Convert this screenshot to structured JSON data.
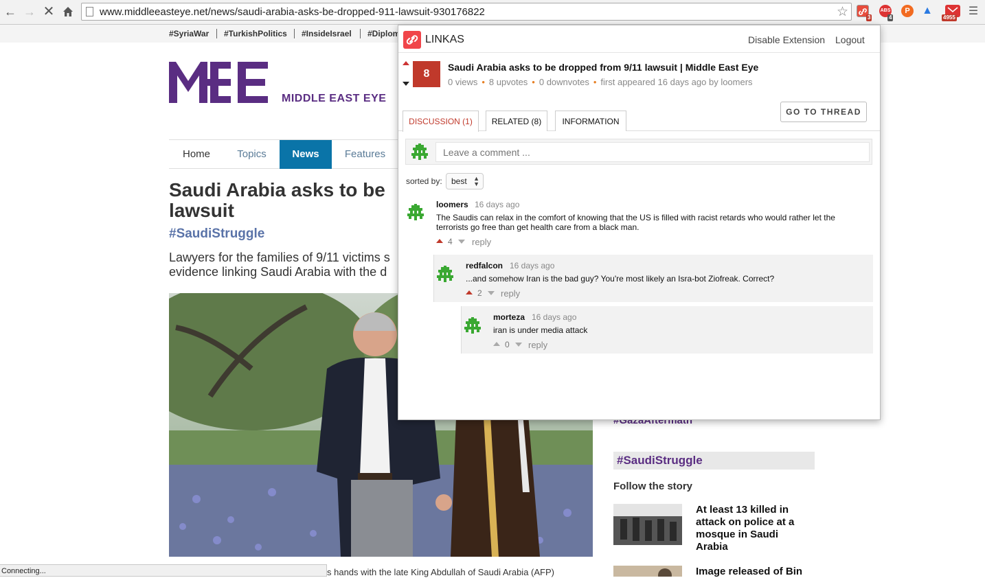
{
  "browser": {
    "url": "www.middleeasteye.net/news/saudi-arabia-asks-be-dropped-911-lawsuit-930176822",
    "linkas_badge": "3",
    "abs_badge": "4",
    "mail_badge": "4955",
    "status_text": "Connecting..."
  },
  "site": {
    "hashtags": [
      "#SyriaWar",
      "#TurkishPolitics",
      "#InsideIsrael",
      "#Diplom"
    ],
    "logo_text": "MIDDLE EAST EYE",
    "nav": [
      "Home",
      "Topics",
      "News",
      "Features"
    ],
    "headline": "Saudi Arabia asks to be ",
    "headline_line2": "lawsuit",
    "article_hashtag": "#SaudiStruggle",
    "lede": "Lawyers for the families of 9/11 victims s evidence linking Saudi Arabia with the d",
    "caption": "s hands with the late King Abdullah of Saudi Arabia (AFP)",
    "sidebar_partial": "#GazaAftermath",
    "sidebar_tag": "#SaudiStruggle",
    "follow_label": "Follow the story",
    "stories": [
      {
        "title": "At least 13 killed in attack on police at a mosque in Saudi Arabia"
      },
      {
        "title": "Image released of Bin"
      }
    ]
  },
  "linkas": {
    "brand": "LINKAS",
    "disable_label": "Disable Extension",
    "logout_label": "Logout",
    "score": "8",
    "title": "Saudi Arabia asks to be dropped from 9/11 lawsuit | Middle East Eye",
    "meta": {
      "views": "0 views",
      "upvotes": "8 upvotes",
      "downvotes": "0 downvotes",
      "first": "first appeared 16 days ago by loomers"
    },
    "goto_label": "GO TO THREAD",
    "tabs": [
      "DISCUSSION (1)",
      "RELATED (8)",
      "INFORMATION"
    ],
    "comment_placeholder": "Leave a comment ...",
    "sorted_label": "sorted by:",
    "sort_value": "best",
    "reply_label": "reply",
    "comments": [
      {
        "user": "loomers",
        "time": "16 days ago",
        "text": "The Saudis can relax in the comfort of knowing that the US is filled with racist retards who would rather let the terrorists go free than get health care from a black man.",
        "score": "4"
      },
      {
        "user": "redfalcon",
        "time": "16 days ago",
        "text": "...and somehow Iran is the bad guy? You're most likely an Isra-bot Ziofreak. Correct?",
        "score": "2"
      },
      {
        "user": "morteza",
        "time": "16 days ago",
        "text": "iran is under media attack",
        "score": "0"
      }
    ]
  },
  "colors": {
    "brand_purple": "#5a2d82",
    "nav_active": "#0a74a8",
    "linkas_red": "#c0392b",
    "linkas_logo": "#f0454a",
    "meta_dot": "#e67e22"
  }
}
